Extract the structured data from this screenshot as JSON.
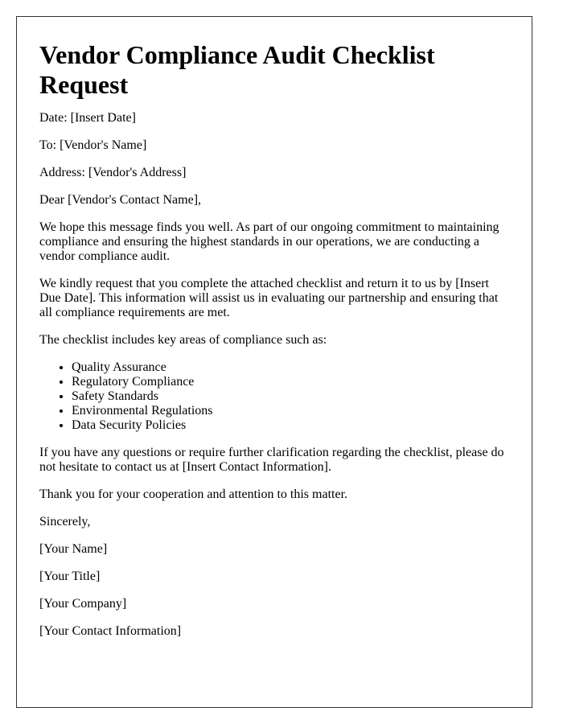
{
  "document": {
    "title": "Vendor Compliance Audit Checklist Request",
    "date_line": "Date: [Insert Date]",
    "to_line": "To: [Vendor's Name]",
    "address_line": "Address: [Vendor's Address]",
    "salutation": "Dear [Vendor's Contact Name],",
    "paragraphs": [
      "We hope this message finds you well. As part of our ongoing commitment to maintaining compliance and ensuring the highest standards in our operations, we are conducting a vendor compliance audit.",
      "We kindly request that you complete the attached checklist and return it to us by [Insert Due Date]. This information will assist us in evaluating our partnership and ensuring that all compliance requirements are met.",
      "The checklist includes key areas of compliance such as:"
    ],
    "checklist_areas": [
      "Quality Assurance",
      "Regulatory Compliance",
      "Safety Standards",
      "Environmental Regulations",
      "Data Security Policies"
    ],
    "closing_paragraphs": [
      "If you have any questions or require further clarification regarding the checklist, please do not hesitate to contact us at [Insert Contact Information].",
      "Thank you for your cooperation and attention to this matter."
    ],
    "sign_off": "Sincerely,",
    "signature": {
      "name": "[Your Name]",
      "title": "[Your Title]",
      "company": "[Your Company]",
      "contact": "[Your Contact Information]"
    }
  }
}
